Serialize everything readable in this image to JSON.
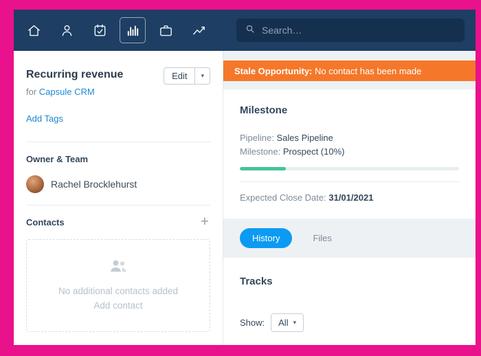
{
  "colors": {
    "frame_pink": "#e9118c",
    "nav_navy": "#1e3e63",
    "link_blue": "#1e88d2",
    "tab_active_blue": "#0d9af2",
    "banner_orange": "#f5782a",
    "progress_green": "#45c398"
  },
  "icons": {
    "chevron_down": "▾",
    "plus": "+"
  },
  "nav": {
    "icons": [
      "home",
      "people",
      "tasks",
      "statistics",
      "cases",
      "sales"
    ],
    "active_icon": "statistics",
    "search_placeholder": "Search…"
  },
  "sidebar": {
    "title": "Recurring revenue",
    "edit_button": "Edit",
    "for_prefix": "for",
    "for_link": "Capsule CRM",
    "add_tags_link": "Add Tags",
    "owner_heading": "Owner & Team",
    "owner_name": "Rachel Brocklehurst",
    "contacts_heading": "Contacts",
    "contacts_empty_text": "No additional contacts added",
    "add_contact_link": "Add contact"
  },
  "main": {
    "banner_prefix": "Stale Opportunity:",
    "banner_rest": " No contact has been made",
    "milestone": {
      "heading": "Milestone",
      "pipeline_label": "Pipeline:",
      "pipeline_value": "Sales Pipeline",
      "milestone_label": "Milestone:",
      "milestone_value": "Prospect (10%)",
      "progress_percent": 21,
      "close_date_label": "Expected Close Date:",
      "close_date_value": "31/01/2021"
    },
    "tabs": [
      {
        "label": "History",
        "active": true
      },
      {
        "label": "Files",
        "active": false
      }
    ],
    "tracks": {
      "heading": "Tracks",
      "show_label": "Show:",
      "filter_value": "All"
    }
  }
}
